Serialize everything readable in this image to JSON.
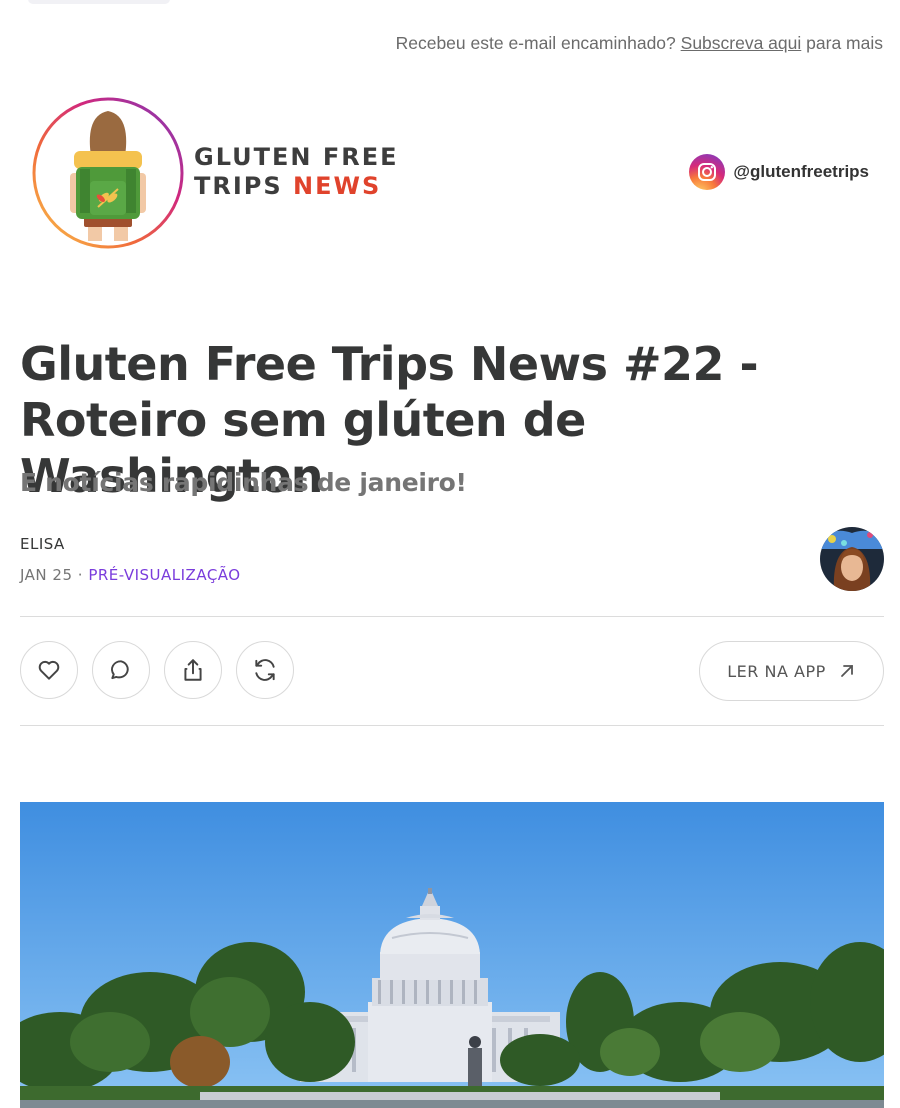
{
  "forward_notice": {
    "prefix": "Recebeu este e-mail encaminhado?",
    "link": "Subscreva aqui",
    "suffix": "para mais"
  },
  "brand": {
    "line1": "GLUTEN FREE",
    "line2_dark": "TRIPS",
    "line2_red": "NEWS"
  },
  "instagram": {
    "icon": "instagram-icon",
    "handle": "@glutenfreetrips"
  },
  "post": {
    "title_line1": "Gluten Free Trips News #22 -",
    "title_line2": "Roteiro sem glúten de Washington",
    "subtitle": "E notícias rapidinhas de janeiro!",
    "author": "ELISA",
    "date": "JAN 25",
    "separator": "·",
    "status": "PRÉ-VISUALIZAÇÃO"
  },
  "actions": {
    "like_icon": "heart-icon",
    "comment_icon": "comment-icon",
    "share_icon": "share-icon",
    "restack_icon": "restack-icon",
    "read_in_app": "LER NA APP",
    "read_icon": "arrow-up-right-icon"
  },
  "colors": {
    "accent": "#7a3cdc",
    "brand_red": "#e0432c",
    "title": "#363737"
  }
}
